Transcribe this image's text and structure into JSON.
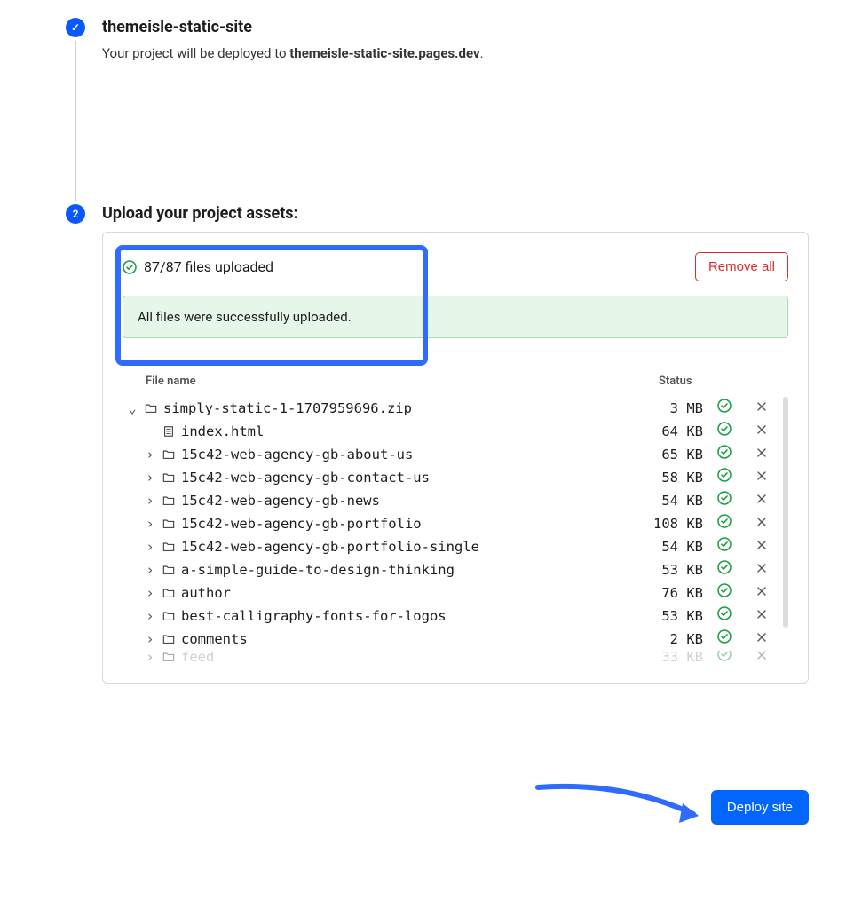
{
  "step1": {
    "title": "themeisle-static-site",
    "subtitle_prefix": "Your project will be deployed to ",
    "subtitle_bold": "themeisle-static-site.pages.dev",
    "subtitle_suffix": "."
  },
  "step2": {
    "number": "2",
    "title": "Upload your project assets:"
  },
  "upload": {
    "status_text": "87/87 files uploaded",
    "remove_all_label": "Remove all",
    "success_message": "All files were successfully uploaded."
  },
  "table": {
    "header_name": "File name",
    "header_status": "Status"
  },
  "files": [
    {
      "expanded": true,
      "indent": 0,
      "type": "folder",
      "name": "simply-static-1-1707959696.zip",
      "size": "3 MB",
      "status": "ok"
    },
    {
      "expanded": null,
      "indent": 1,
      "type": "file",
      "name": "index.html",
      "size": "64 KB",
      "status": "ok"
    },
    {
      "expanded": false,
      "indent": 1,
      "type": "folder",
      "name": "15c42-web-agency-gb-about-us",
      "size": "65 KB",
      "status": "ok"
    },
    {
      "expanded": false,
      "indent": 1,
      "type": "folder",
      "name": "15c42-web-agency-gb-contact-us",
      "size": "58 KB",
      "status": "ok"
    },
    {
      "expanded": false,
      "indent": 1,
      "type": "folder",
      "name": "15c42-web-agency-gb-news",
      "size": "54 KB",
      "status": "ok"
    },
    {
      "expanded": false,
      "indent": 1,
      "type": "folder",
      "name": "15c42-web-agency-gb-portfolio",
      "size": "108 KB",
      "status": "ok"
    },
    {
      "expanded": false,
      "indent": 1,
      "type": "folder",
      "name": "15c42-web-agency-gb-portfolio-single",
      "size": "54 KB",
      "status": "ok"
    },
    {
      "expanded": false,
      "indent": 1,
      "type": "folder",
      "name": "a-simple-guide-to-design-thinking",
      "size": "53 KB",
      "status": "ok"
    },
    {
      "expanded": false,
      "indent": 1,
      "type": "folder",
      "name": "author",
      "size": "76 KB",
      "status": "ok"
    },
    {
      "expanded": false,
      "indent": 1,
      "type": "folder",
      "name": "best-calligraphy-fonts-for-logos",
      "size": "53 KB",
      "status": "ok"
    },
    {
      "expanded": false,
      "indent": 1,
      "type": "folder",
      "name": "comments",
      "size": "2 KB",
      "status": "ok"
    },
    {
      "expanded": false,
      "indent": 1,
      "type": "folder",
      "name": "feed",
      "size": "33 KB",
      "status": "ok",
      "partial": true
    }
  ],
  "deploy": {
    "label": "Deploy site"
  }
}
